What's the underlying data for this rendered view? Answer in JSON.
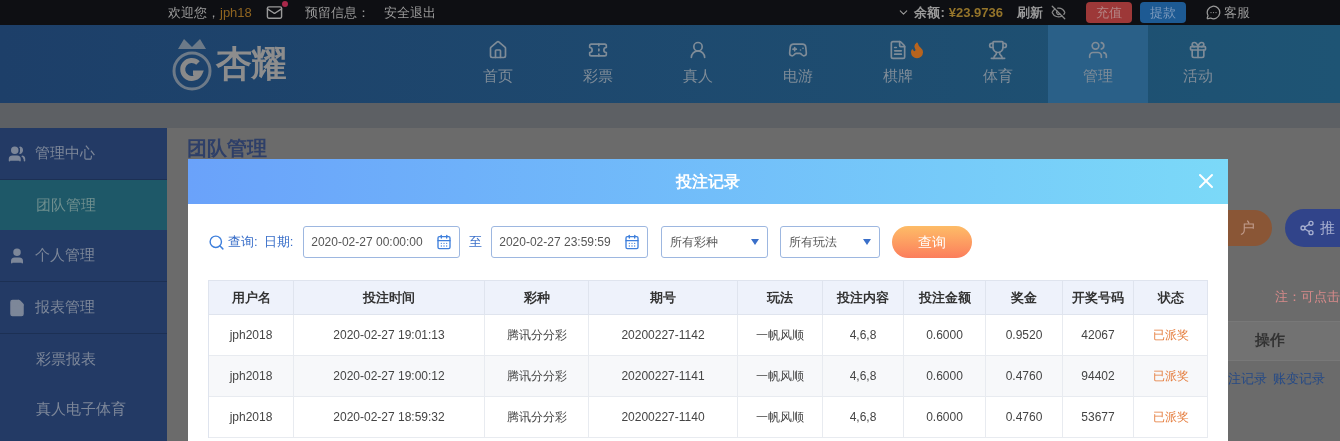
{
  "top_bar": {
    "welcome": "欢迎您，",
    "username": "jph18",
    "has_unread": true,
    "reserved_label": "预留信息：",
    "logout": "安全退出",
    "balance_label": "余额:",
    "balance": "¥23.9736",
    "refresh": "刷新",
    "deposit": "充值",
    "withdraw": "提款",
    "service": "客服"
  },
  "logo": {
    "text": "杏耀"
  },
  "nav": [
    {
      "label": "首页",
      "selected": false,
      "hot": false
    },
    {
      "label": "彩票",
      "selected": false,
      "hot": false
    },
    {
      "label": "真人",
      "selected": false,
      "hot": false
    },
    {
      "label": "电游",
      "selected": false,
      "hot": false
    },
    {
      "label": "棋牌",
      "selected": false,
      "hot": true
    },
    {
      "label": "体育",
      "selected": false,
      "hot": false
    },
    {
      "label": "管理",
      "selected": true,
      "hot": false
    },
    {
      "label": "活动",
      "selected": false,
      "hot": false
    }
  ],
  "sidebar": [
    {
      "kind": "section",
      "label": "管理中心",
      "selected": false
    },
    {
      "kind": "link",
      "label": "团队管理",
      "selected": true
    },
    {
      "kind": "section",
      "label": "个人管理",
      "selected": false
    },
    {
      "kind": "section",
      "label": "报表管理",
      "selected": false
    },
    {
      "kind": "link",
      "label": "彩票报表",
      "selected": false
    },
    {
      "kind": "link",
      "label": "真人电子体育",
      "selected": false
    }
  ],
  "page": {
    "title": "团队管理",
    "open_account": "户",
    "promote": "推",
    "note": "注：可点击",
    "action_header": "操作",
    "links": [
      "注记录",
      "账变记录"
    ]
  },
  "dialog": {
    "title": "投注记录",
    "filters": {
      "query_label": "查询:",
      "date_label": "日期:",
      "start": "2020-02-27 00:00:00",
      "to": "至",
      "end": "2020-02-27 23:59:59",
      "lottery": "所有彩种",
      "play": "所有玩法",
      "button": "查询"
    },
    "table": {
      "columns": [
        "用户名",
        "投注时间",
        "彩种",
        "期号",
        "玩法",
        "投注内容",
        "投注金额",
        "奖金",
        "开奖号码",
        "状态"
      ],
      "rows": [
        [
          "jph2018",
          "2020-02-27 19:01:13",
          "腾讯分分彩",
          "20200227-1142",
          "一帆风顺",
          "4,6,8",
          "0.6000",
          "0.9520",
          "42067",
          "已派奖"
        ],
        [
          "jph2018",
          "2020-02-27 19:00:12",
          "腾讯分分彩",
          "20200227-1141",
          "一帆风顺",
          "4,6,8",
          "0.6000",
          "0.4760",
          "94402",
          "已派奖"
        ],
        [
          "jph2018",
          "2020-02-27 18:59:32",
          "腾讯分分彩",
          "20200227-1140",
          "一帆风顺",
          "4,6,8",
          "0.6000",
          "0.4760",
          "53677",
          "已派奖"
        ]
      ]
    }
  }
}
